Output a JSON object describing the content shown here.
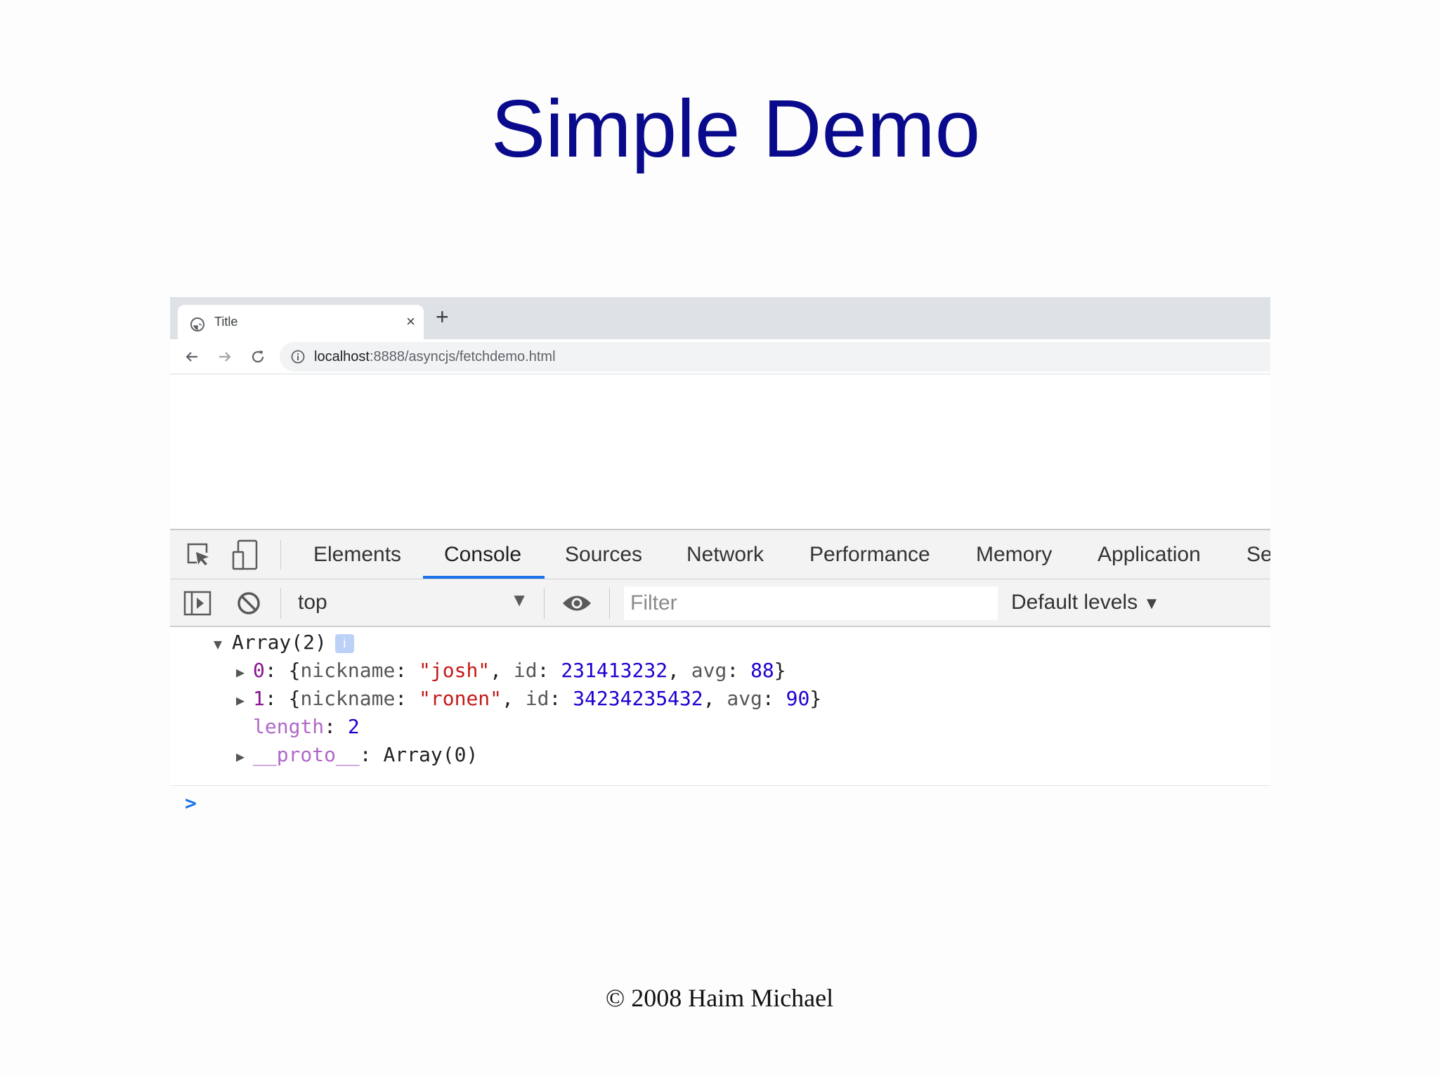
{
  "slide": {
    "title": "Simple Demo",
    "footer": "© 2008 Haim Michael"
  },
  "browser": {
    "tab": {
      "title": "Title",
      "close": "×"
    },
    "new_tab": "+",
    "url_host": "localhost",
    "url_rest": ":8888/asyncjs/fetchdemo.html"
  },
  "devtools": {
    "tabs": [
      "Elements",
      "Console",
      "Sources",
      "Network",
      "Performance",
      "Memory",
      "Application",
      "Se"
    ],
    "active_tab": "Console",
    "context": "top",
    "filter_placeholder": "Filter",
    "levels": "Default levels",
    "accent_color": "#1a73e8"
  },
  "console": {
    "array_label": "Array(2)",
    "badge": "i",
    "items": [
      {
        "index": "0",
        "nickname": "\"josh\"",
        "id": "231413232",
        "avg": "88"
      },
      {
        "index": "1",
        "nickname": "\"ronen\"",
        "id": "34234235432",
        "avg": "90"
      }
    ],
    "length_key": "length",
    "length_value": "2",
    "proto_key": "__proto__",
    "proto_value": "Array(0)",
    "prompt": ">"
  },
  "icons": [
    "globe-icon",
    "back-arrow-icon",
    "forward-arrow-icon",
    "reload-icon",
    "info-icon",
    "inspect-element-icon",
    "device-toolbar-icon",
    "sidebar-toggle-icon",
    "clear-console-icon",
    "eye-icon"
  ]
}
